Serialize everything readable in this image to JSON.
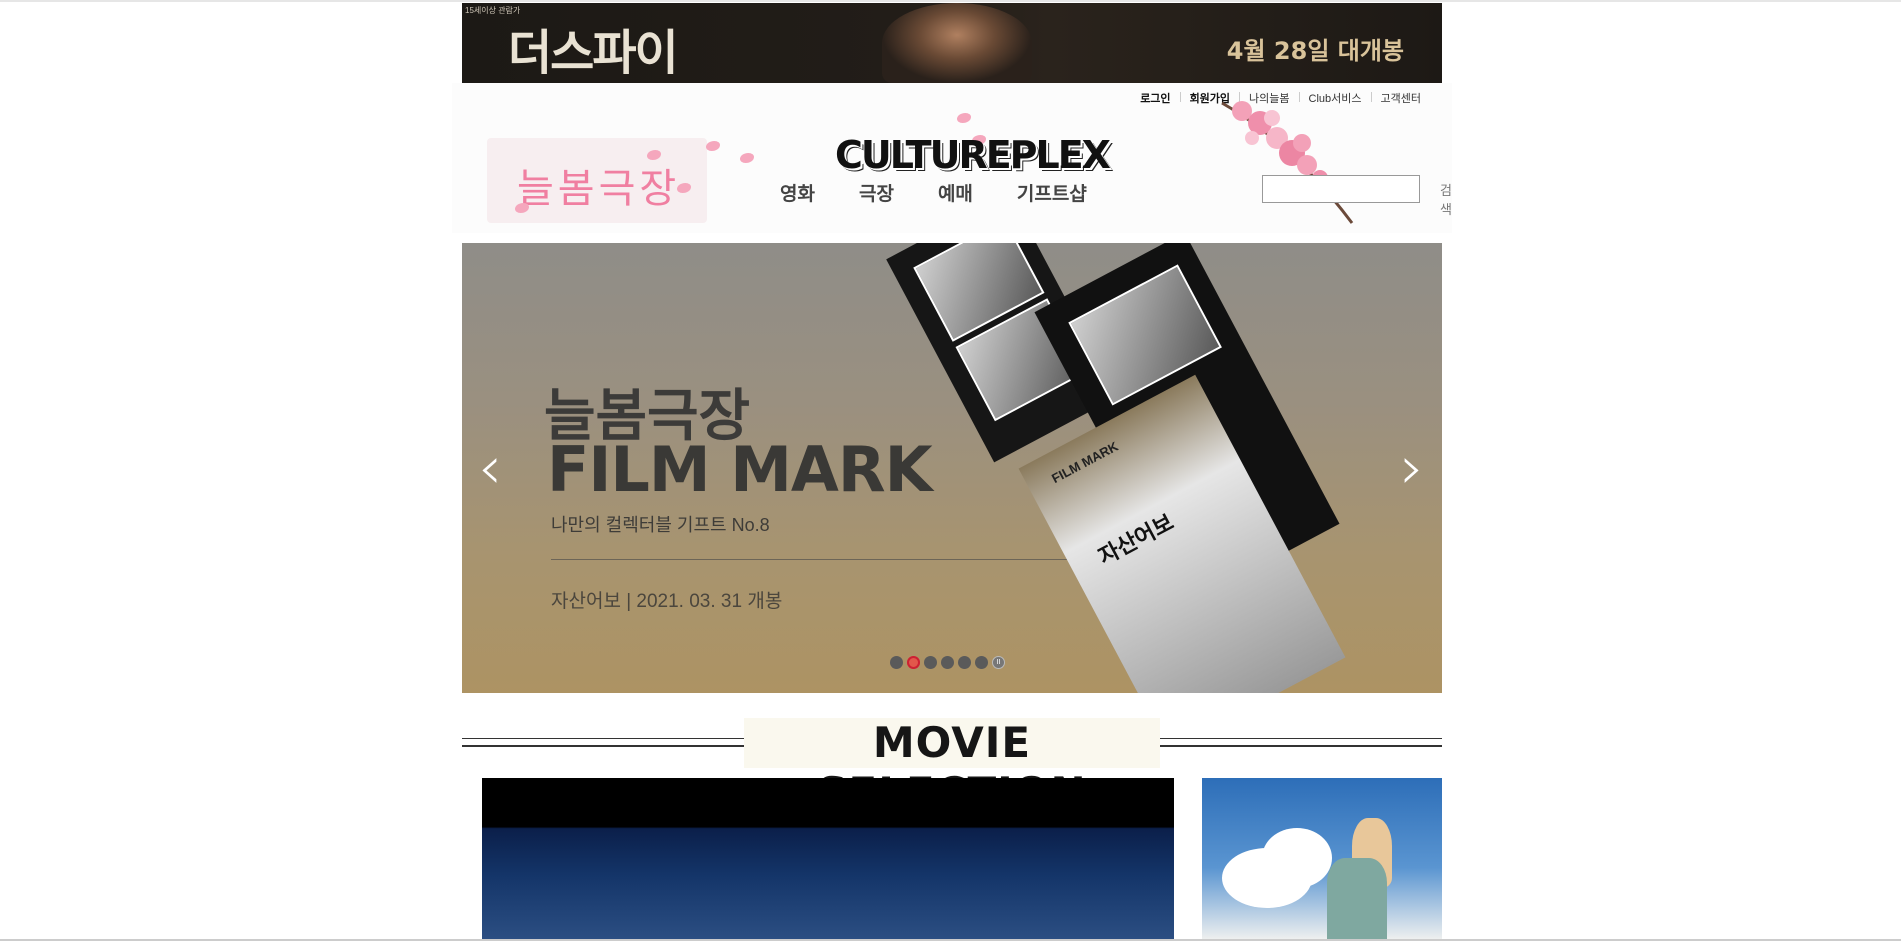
{
  "ad": {
    "rating": "15세이상 관람가",
    "title": "더스파이",
    "date": "4월 28일 대개봉"
  },
  "util_menu": [
    "로그인",
    "회원가입",
    "나의늘봄",
    "Club서비스",
    "고객센터"
  ],
  "logo": {
    "left_text": "늘봄극장",
    "brand": "CULTUREPLEX"
  },
  "gnb": [
    "영화",
    "극장",
    "예매",
    "기프트샵"
  ],
  "search": {
    "placeholder": "",
    "button": "검색"
  },
  "hero": {
    "title_ko": "늘봄극장",
    "title_en": "FILM MARK",
    "subtitle": "나만의 컬렉터블 기프트 No.8",
    "info": "자산어보 | 2021. 03. 31 개봉",
    "card_label": "FILM MARK",
    "card_title": "자산어보",
    "prev_arrow": "‹",
    "next_arrow": "›",
    "slide_count": 6,
    "active_slide": 2,
    "pause_glyph": "II"
  },
  "section": {
    "title": "MOVIE SELECTION"
  }
}
